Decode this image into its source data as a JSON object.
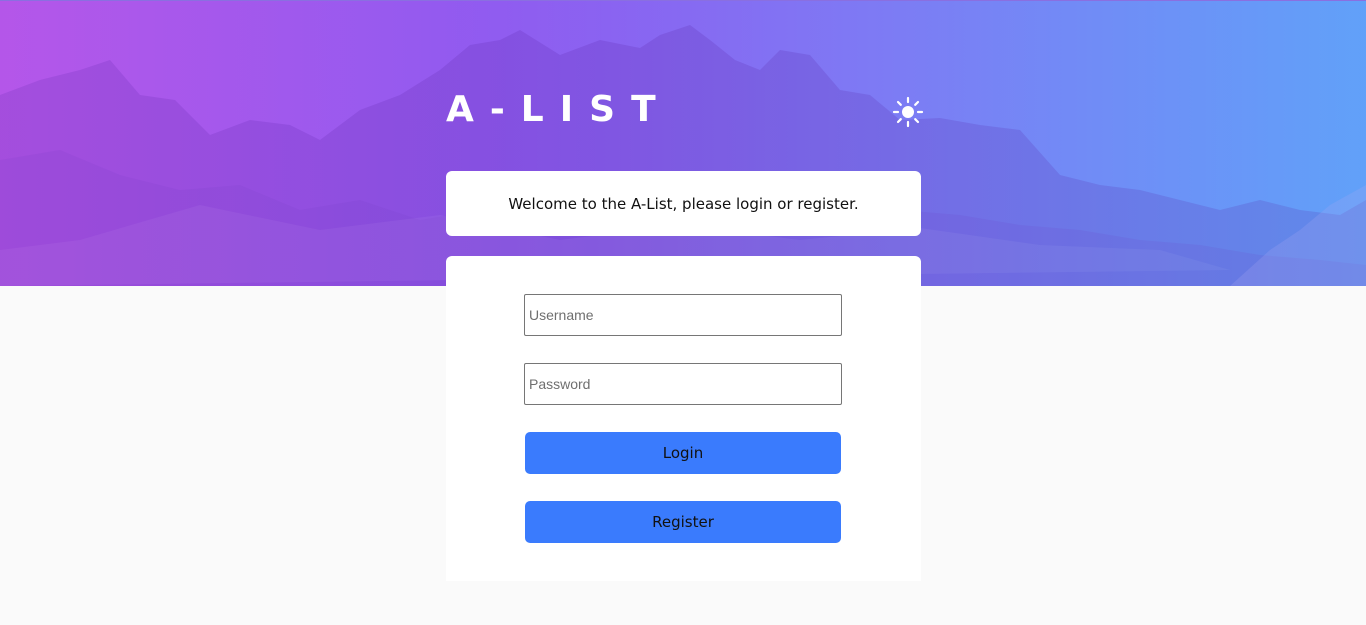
{
  "header": {
    "logo_text": "A-LIST",
    "theme_toggle_icon": "sun-icon"
  },
  "welcome": {
    "message": "Welcome to the A-List, please login or register."
  },
  "login_form": {
    "username_placeholder": "Username",
    "username_value": "",
    "password_placeholder": "Password",
    "password_value": "",
    "login_label": "Login",
    "register_label": "Register"
  },
  "colors": {
    "button_accent": "#3a7bfd",
    "hero_gradient_start": "#b25ae8",
    "hero_gradient_end": "#62a1f8",
    "page_background": "#fafafa"
  }
}
